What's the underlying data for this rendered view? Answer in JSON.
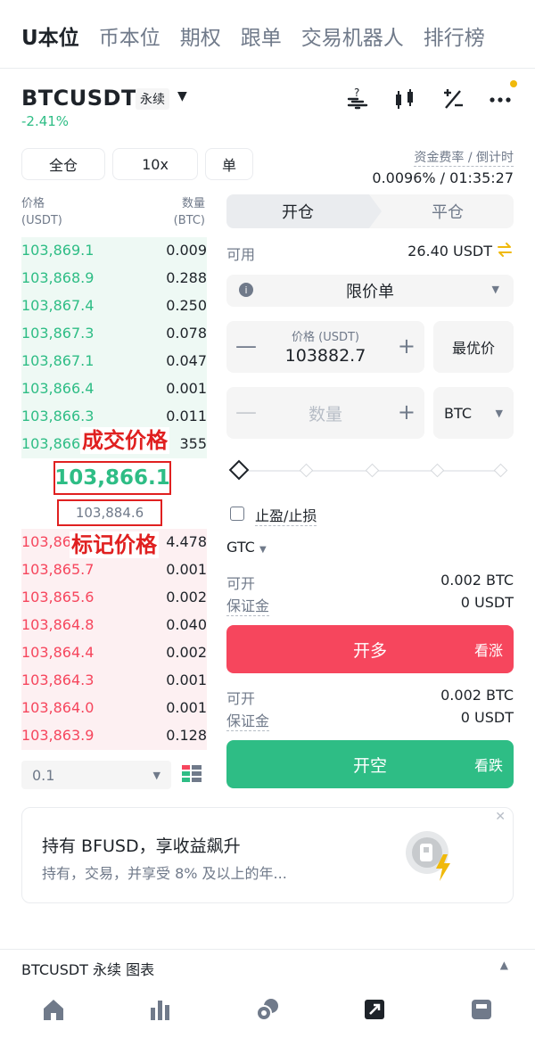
{
  "top_tabs": [
    "U本位",
    "币本位",
    "期权",
    "跟单",
    "交易机器人",
    "排行榜"
  ],
  "header": {
    "symbol": "BTCUSDT",
    "contract_type": "永续",
    "change": "-2.41%"
  },
  "controls": {
    "margin_mode": "全仓",
    "leverage": "10x",
    "position_mode": "单"
  },
  "funding": {
    "label": "资金费率 / 倒计时",
    "value": "0.0096% / 01:35:27"
  },
  "orderbook": {
    "price_header": "价格",
    "price_unit": "(USDT)",
    "qty_header": "数量",
    "qty_unit": "(BTC)",
    "asks": [
      {
        "price": "103,869.1",
        "qty": "0.009"
      },
      {
        "price": "103,868.9",
        "qty": "0.288"
      },
      {
        "price": "103,867.4",
        "qty": "0.250"
      },
      {
        "price": "103,867.3",
        "qty": "0.078"
      },
      {
        "price": "103,867.1",
        "qty": "0.047"
      },
      {
        "price": "103,866.4",
        "qty": "0.001"
      },
      {
        "price": "103,866.3",
        "qty": "0.011"
      },
      {
        "price": "103,866",
        "qty": "355"
      }
    ],
    "last_price": "103,866.1",
    "mark_price": "103,884.6",
    "bids": [
      {
        "price": "103,86",
        "qty": "4.478"
      },
      {
        "price": "103,865.7",
        "qty": "0.001"
      },
      {
        "price": "103,865.6",
        "qty": "0.002"
      },
      {
        "price": "103,864.8",
        "qty": "0.040"
      },
      {
        "price": "103,864.4",
        "qty": "0.002"
      },
      {
        "price": "103,864.3",
        "qty": "0.001"
      },
      {
        "price": "103,864.0",
        "qty": "0.001"
      },
      {
        "price": "103,863.9",
        "qty": "0.128"
      }
    ],
    "precision": "0.1"
  },
  "annotations": {
    "last_price_label": "成交价格",
    "mark_price_label": "标记价格"
  },
  "trade_form": {
    "open_tab": "开仓",
    "close_tab": "平仓",
    "available_label": "可用",
    "available_value": "26.40 USDT",
    "order_type": "限价单",
    "price_label": "价格 (USDT)",
    "price_value": "103882.7",
    "best_price": "最优价",
    "qty_placeholder": "数量",
    "qty_unit": "BTC",
    "tpsl_label": "止盈/止损",
    "tif": "GTC",
    "long": {
      "can_open_label": "可开",
      "can_open_value": "0.002 BTC",
      "margin_label": "保证金",
      "margin_value": "0 USDT",
      "button": "开多",
      "button_sub": "看涨"
    },
    "short": {
      "can_open_label": "可开",
      "can_open_value": "0.002 BTC",
      "margin_label": "保证金",
      "margin_value": "0 USDT",
      "button": "开空",
      "button_sub": "看跌"
    }
  },
  "promo": {
    "title": "持有 BFUSD，享收益飙升",
    "subtitle": "持有，交易，并享受 8% 及以上的年..."
  },
  "bottom_bar": {
    "label": "BTCUSDT 永续  图表"
  },
  "colors": {
    "up": "#2ebd85",
    "down": "#f6465d",
    "accent": "#f0b90b",
    "annotation": "#e02020"
  }
}
